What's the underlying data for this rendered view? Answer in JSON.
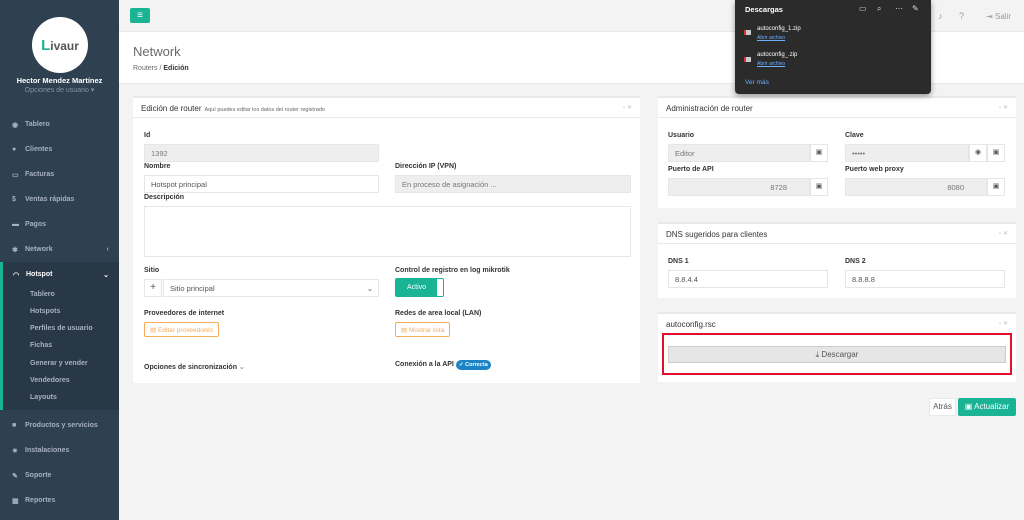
{
  "sidebar": {
    "logo_text": "ivaur",
    "logo_letter": "L",
    "user_name": "Hector Mendez Martínez",
    "user_options": "Opciones de usuario ▾",
    "items": [
      {
        "label": "Tablero"
      },
      {
        "label": "Clientes"
      },
      {
        "label": "Facturas"
      },
      {
        "label": "Ventas rápidas"
      },
      {
        "label": "Pagos"
      },
      {
        "label": "Network"
      },
      {
        "label": "Hotspot"
      },
      {
        "label": "Productos y servicios"
      },
      {
        "label": "Instalaciones"
      },
      {
        "label": "Soporte"
      },
      {
        "label": "Reportes"
      }
    ],
    "hotspot_sub": [
      "Tablero",
      "Hotspots",
      "Perfiles de usuario",
      "Fichas",
      "Generar y vender",
      "Vendedores",
      "Layouts"
    ]
  },
  "topbar": {
    "logout": "Salir"
  },
  "heading": {
    "title": "Network",
    "crumb_1": "Routers",
    "crumb_sep": "/",
    "crumb_2": "Edición"
  },
  "downloads": {
    "title": "Descargas",
    "files": [
      {
        "name": "autoconfig_1.zip",
        "link": "Abrir archivo"
      },
      {
        "name": "autoconfig_.zip",
        "link": "Abrir archivo"
      }
    ],
    "more": "Ver más"
  },
  "edit_panel": {
    "title": "Edición de router",
    "subtitle": "Aquí puedes editar los datos del router registrado",
    "id_label": "Id",
    "id_value": "1392",
    "name_label": "Nombre",
    "name_value": "Hotspot principal",
    "ip_label": "Dirección IP (VPN)",
    "ip_value": "En proceso de asignación ...",
    "desc_label": "Descripción",
    "site_label": "Sitio",
    "site_value": "Sitio principal",
    "log_label": "Control de registro en log mikrotik",
    "log_value": "Activo",
    "isp_label": "Proveedores de internet",
    "isp_button": "Editar proveedores",
    "lan_label": "Redes de area local (LAN)",
    "lan_button": "Mostrar lista",
    "sync_label": "Opciones de sincronización",
    "api_label": "Conexión a la API",
    "api_badge": "Correcta"
  },
  "admin_panel": {
    "title": "Administración de router",
    "user_label": "Usuario",
    "user_value": "Editor",
    "key_label": "Clave",
    "key_value": "•••••",
    "api_port_label": "Puerto de API",
    "api_port_value": "8728",
    "proxy_label": "Puerto web proxy",
    "proxy_value": "8080"
  },
  "dns_panel": {
    "title": "DNS sugeridos para clientes",
    "dns1_label": "DNS 1",
    "dns1_value": "8.8.4.4",
    "dns2_label": "DNS 2",
    "dns2_value": "8.8.8.8"
  },
  "autoconfig_panel": {
    "title": "autoconfig.rsc",
    "download_button": "Descargar"
  },
  "actions": {
    "back": "Atrás",
    "update": "Actualizar"
  },
  "colors": {
    "accent": "#1ab394",
    "sidebar": "#2f4050",
    "highlight": "#e0102a"
  }
}
